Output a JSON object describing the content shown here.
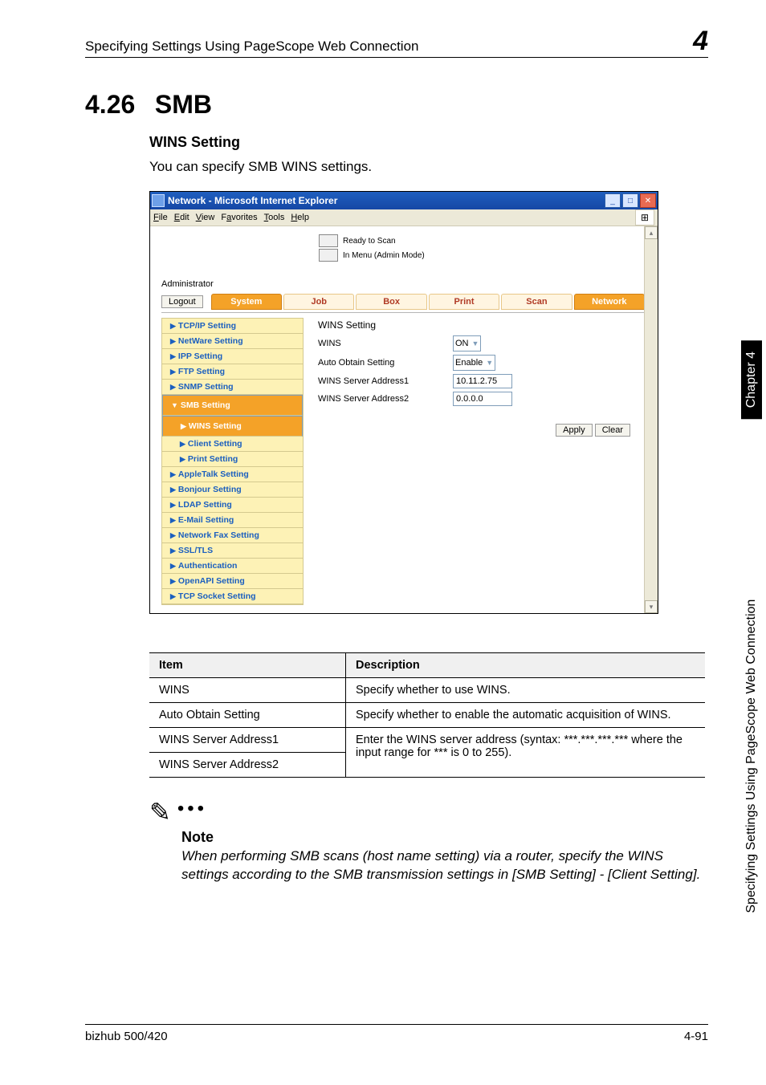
{
  "header": {
    "running_title": "Specifying Settings Using PageScope Web Connection",
    "chapter_num_big": "4"
  },
  "section": {
    "number": "4.26",
    "title": "SMB",
    "subheading": "WINS Setting",
    "intro": "You can specify SMB WINS settings."
  },
  "screenshot": {
    "window_title": "Network - Microsoft Internet Explorer",
    "menu": {
      "file": "File",
      "edit": "Edit",
      "view": "View",
      "favorites": "Favorites",
      "tools": "Tools",
      "help": "Help"
    },
    "status1": "Ready to Scan",
    "status2": "In Menu (Admin Mode)",
    "admin_label": "Administrator",
    "logout": "Logout",
    "tabs": {
      "system": "System",
      "job": "Job",
      "box": "Box",
      "print": "Print",
      "scan": "Scan",
      "network": "Network"
    },
    "sidemenu": [
      "TCP/IP Setting",
      "NetWare Setting",
      "IPP Setting",
      "FTP Setting",
      "SNMP Setting",
      "SMB Setting",
      "WINS Setting",
      "Client Setting",
      "Print Setting",
      "AppleTalk Setting",
      "Bonjour Setting",
      "LDAP Setting",
      "E-Mail Setting",
      "Network Fax Setting",
      "SSL/TLS",
      "Authentication",
      "OpenAPI Setting",
      "TCP Socket Setting"
    ],
    "panel": {
      "heading": "WINS Setting",
      "wins_label": "WINS",
      "wins_value": "ON",
      "auto_label": "Auto Obtain Setting",
      "auto_value": "Enable",
      "addr1_label": "WINS Server Address1",
      "addr1_value": "10.11.2.75",
      "addr2_label": "WINS Server Address2",
      "addr2_value": "0.0.0.0",
      "apply": "Apply",
      "clear": "Clear"
    }
  },
  "table": {
    "head_item": "Item",
    "head_desc": "Description",
    "rows": {
      "r1_item": "WINS",
      "r1_desc": "Specify whether to use WINS.",
      "r2_item": "Auto Obtain Setting",
      "r2_desc": "Specify whether to enable the automatic acquisition of WINS.",
      "r3_item": "WINS Server Address1",
      "r34_desc": "Enter the WINS server address (syntax: ***.***.***.*** where the input range for *** is 0 to 255).",
      "r4_item": "WINS Server Address2"
    }
  },
  "note": {
    "title": "Note",
    "text": "When performing SMB scans (host name setting) via a router, specify the WINS settings according to the SMB transmission settings in [SMB Setting] - [Client Setting]."
  },
  "sidetab": {
    "chapter": "Chapter 4",
    "text": "Specifying Settings Using PageScope Web Connection"
  },
  "footer": {
    "left": "bizhub 500/420",
    "right": "4-91"
  }
}
